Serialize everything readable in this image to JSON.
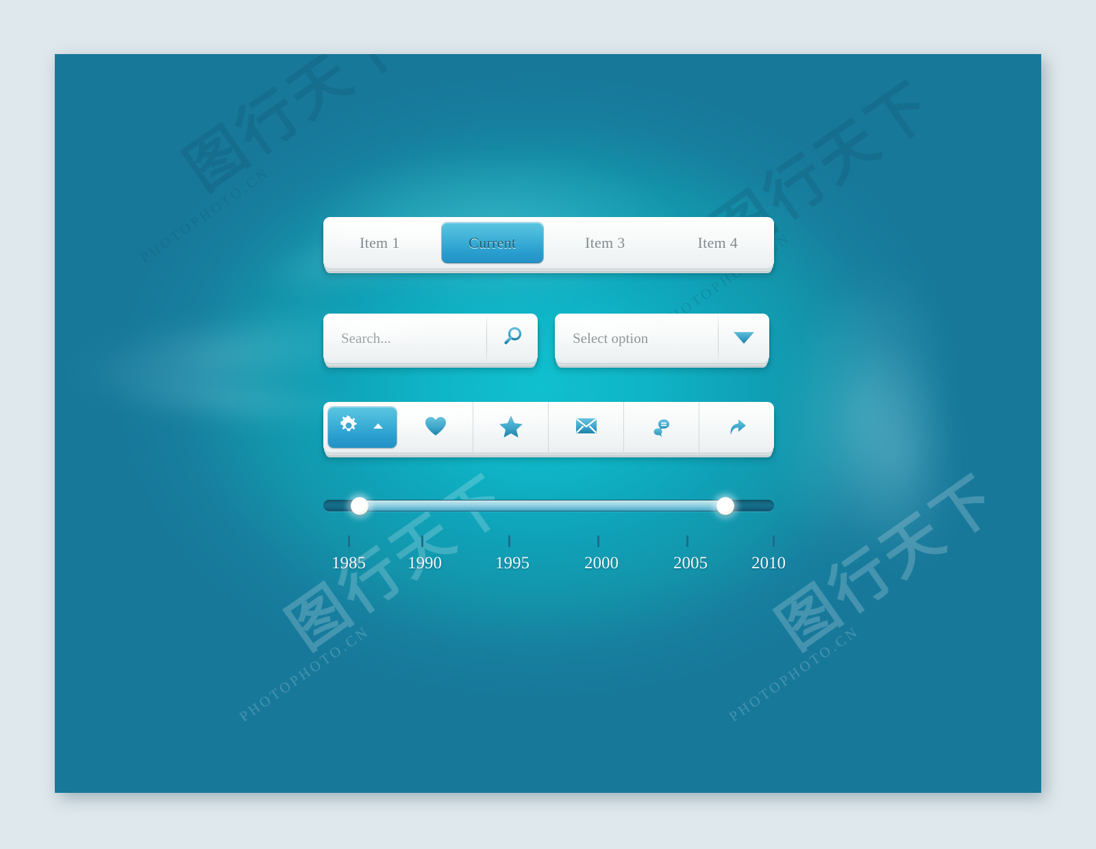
{
  "colors": {
    "page_background": "#dfe8ec",
    "canvas_teal_center": "#10c0cf",
    "canvas_teal_edge": "#17789a",
    "accent_blue": "#2a9fcf",
    "accent_blue_light": "#5bc6e2",
    "icon_blue": "#3aa2c7",
    "track_dark": "#15708c",
    "track_fill": "#9ed5e4",
    "text_muted": "#808a8d",
    "text_active": "#1a5f75"
  },
  "watermarks": {
    "site": "PHOTOPHOTO.CN",
    "brand": "图行天下"
  },
  "tabbar": {
    "name": "segmented-tab-bar",
    "tabs": [
      {
        "label": "Item 1",
        "active": false
      },
      {
        "label": "Current",
        "active": true
      },
      {
        "label": "Item 3",
        "active": false
      },
      {
        "label": "Item 4",
        "active": false
      }
    ]
  },
  "search": {
    "name": "search-field",
    "value": "",
    "placeholder": "Search...",
    "button_icon": "search-icon"
  },
  "select": {
    "name": "select-dropdown",
    "selected_label": "Select option",
    "button_icon": "chevron-down-icon"
  },
  "iconbar": {
    "name": "icon-toolbar",
    "items": [
      {
        "icon": "gear-icon",
        "label": "Settings",
        "active": true,
        "has_caret": true,
        "caret_icon": "caret-up-icon"
      },
      {
        "icon": "heart-icon",
        "label": "Favorite",
        "active": false,
        "has_caret": false
      },
      {
        "icon": "star-icon",
        "label": "Star",
        "active": false,
        "has_caret": false
      },
      {
        "icon": "envelope-icon",
        "label": "Mail",
        "active": false,
        "has_caret": false
      },
      {
        "icon": "chat-bubble-icon",
        "label": "Comments",
        "active": false,
        "has_caret": false
      },
      {
        "icon": "share-arrow-icon",
        "label": "Share",
        "active": false,
        "has_caret": false
      }
    ]
  },
  "slider": {
    "name": "year-range-slider",
    "min": 1983,
    "max": 2012,
    "value_low": 1985,
    "value_high": 2007,
    "ticks": [
      {
        "label": "1985",
        "pos_pct": 6
      },
      {
        "label": "1990",
        "pos_pct": 22
      },
      {
        "label": "1995",
        "pos_pct": 41
      },
      {
        "label": "2000",
        "pos_pct": 61
      },
      {
        "label": "2005",
        "pos_pct": 81
      },
      {
        "label": "2010",
        "pos_pct": 99
      }
    ]
  }
}
